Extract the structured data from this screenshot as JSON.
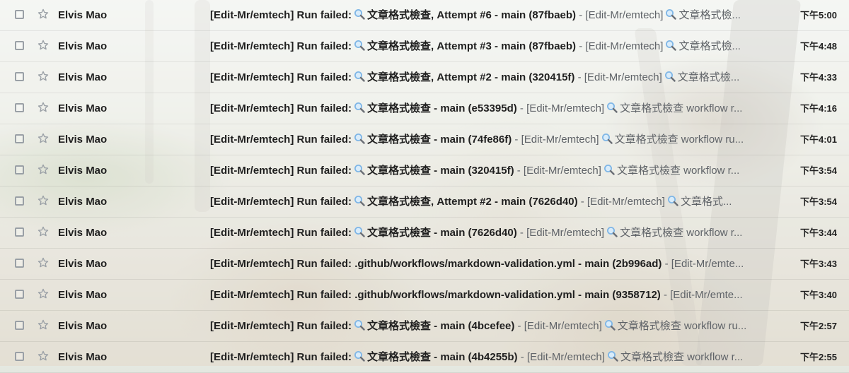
{
  "emails": [
    {
      "sender": "Elvis Mao",
      "subject_prefix": "[Edit-Mr/emtech] Run failed:",
      "subject_rest": "文章格式檢查, Attempt #6 - main (87fbaeb)",
      "separator": " - ",
      "snippet_prefix": "[Edit-Mr/emtech]",
      "snippet_rest": "文章格式檢...",
      "time": "下午5:00",
      "subject_has_icon": true,
      "snippet_has_icon": true
    },
    {
      "sender": "Elvis Mao",
      "subject_prefix": "[Edit-Mr/emtech] Run failed:",
      "subject_rest": "文章格式檢查, Attempt #3 - main (87fbaeb)",
      "separator": " - ",
      "snippet_prefix": "[Edit-Mr/emtech]",
      "snippet_rest": "文章格式檢...",
      "time": "下午4:48",
      "subject_has_icon": true,
      "snippet_has_icon": true
    },
    {
      "sender": "Elvis Mao",
      "subject_prefix": "[Edit-Mr/emtech] Run failed:",
      "subject_rest": "文章格式檢查, Attempt #2 - main (320415f)",
      "separator": " - ",
      "snippet_prefix": "[Edit-Mr/emtech]",
      "snippet_rest": "文章格式檢...",
      "time": "下午4:33",
      "subject_has_icon": true,
      "snippet_has_icon": true
    },
    {
      "sender": "Elvis Mao",
      "subject_prefix": "[Edit-Mr/emtech] Run failed:",
      "subject_rest": "文章格式檢查 - main (e53395d)",
      "separator": " - ",
      "snippet_prefix": "[Edit-Mr/emtech]",
      "snippet_rest": "文章格式檢查 workflow r...",
      "time": "下午4:16",
      "subject_has_icon": true,
      "snippet_has_icon": true
    },
    {
      "sender": "Elvis Mao",
      "subject_prefix": "[Edit-Mr/emtech] Run failed:",
      "subject_rest": "文章格式檢查 - main (74fe86f)",
      "separator": " - ",
      "snippet_prefix": "[Edit-Mr/emtech]",
      "snippet_rest": "文章格式檢查 workflow ru...",
      "time": "下午4:01",
      "subject_has_icon": true,
      "snippet_has_icon": true
    },
    {
      "sender": "Elvis Mao",
      "subject_prefix": "[Edit-Mr/emtech] Run failed:",
      "subject_rest": "文章格式檢查 - main (320415f)",
      "separator": " - ",
      "snippet_prefix": "[Edit-Mr/emtech]",
      "snippet_rest": "文章格式檢查 workflow r...",
      "time": "下午3:54",
      "subject_has_icon": true,
      "snippet_has_icon": true
    },
    {
      "sender": "Elvis Mao",
      "subject_prefix": "[Edit-Mr/emtech] Run failed:",
      "subject_rest": "文章格式檢查, Attempt #2 - main (7626d40)",
      "separator": " - ",
      "snippet_prefix": "[Edit-Mr/emtech]",
      "snippet_rest": "文章格式...",
      "time": "下午3:54",
      "subject_has_icon": true,
      "snippet_has_icon": true
    },
    {
      "sender": "Elvis Mao",
      "subject_prefix": "[Edit-Mr/emtech] Run failed:",
      "subject_rest": "文章格式檢查 - main (7626d40)",
      "separator": " - ",
      "snippet_prefix": "[Edit-Mr/emtech]",
      "snippet_rest": "文章格式檢查 workflow r...",
      "time": "下午3:44",
      "subject_has_icon": true,
      "snippet_has_icon": true
    },
    {
      "sender": "Elvis Mao",
      "subject_prefix": "[Edit-Mr/emtech] Run failed:",
      "subject_rest": ".github/workflows/markdown-validation.yml - main (2b996ad)",
      "separator": " - ",
      "snippet_prefix": "[Edit-Mr/emte...",
      "snippet_rest": "",
      "time": "下午3:43",
      "subject_has_icon": false,
      "snippet_has_icon": false
    },
    {
      "sender": "Elvis Mao",
      "subject_prefix": "[Edit-Mr/emtech] Run failed:",
      "subject_rest": ".github/workflows/markdown-validation.yml - main (9358712)",
      "separator": " - ",
      "snippet_prefix": "[Edit-Mr/emte...",
      "snippet_rest": "",
      "time": "下午3:40",
      "subject_has_icon": false,
      "snippet_has_icon": false
    },
    {
      "sender": "Elvis Mao",
      "subject_prefix": "[Edit-Mr/emtech] Run failed:",
      "subject_rest": "文章格式檢查 - main (4bcefee)",
      "separator": " - ",
      "snippet_prefix": "[Edit-Mr/emtech]",
      "snippet_rest": "文章格式檢查 workflow ru...",
      "time": "下午2:57",
      "subject_has_icon": true,
      "snippet_has_icon": true
    },
    {
      "sender": "Elvis Mao",
      "subject_prefix": "[Edit-Mr/emtech] Run failed:",
      "subject_rest": "文章格式檢查 - main (4b4255b)",
      "separator": " - ",
      "snippet_prefix": "[Edit-Mr/emtech]",
      "snippet_rest": "文章格式檢查 workflow r...",
      "time": "下午2:55",
      "subject_has_icon": true,
      "snippet_has_icon": true
    }
  ],
  "icons": {
    "checkbox": "checkbox-icon",
    "star": "star-icon",
    "magnifier": "magnifying-glass-icon"
  },
  "colors": {
    "text_primary": "#1f1f1f",
    "text_secondary": "#5f6368",
    "magnifier_lens": "#7fb6e6",
    "magnifier_handle": "#6b6f76"
  }
}
